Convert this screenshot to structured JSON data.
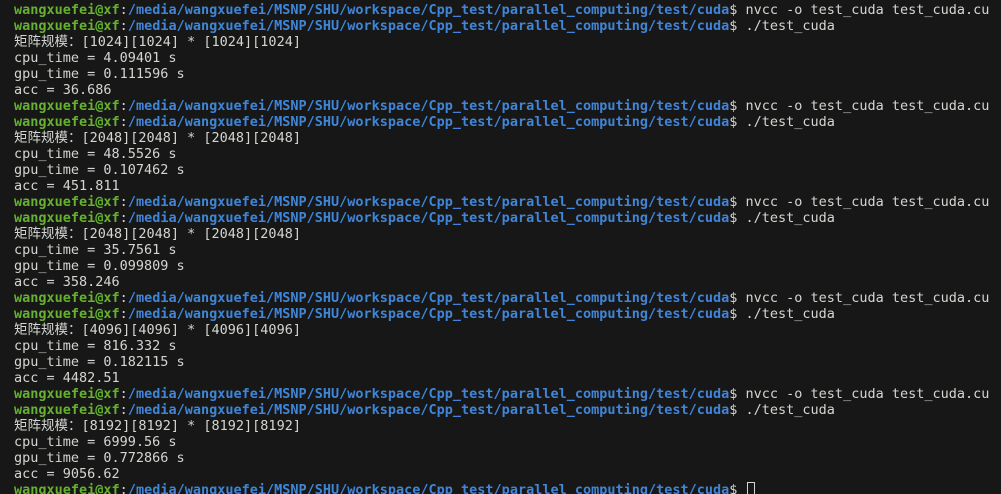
{
  "prompt": {
    "user_host": "wangxuefei@xf",
    "colon": ":",
    "path": "/media/wangxuefei/MSNP/SHU/workspace/Cpp_test/parallel_computing/test/cuda",
    "dollar": "$ "
  },
  "lines": [
    {
      "type": "prompt",
      "command": "nvcc -o test_cuda test_cuda.cu"
    },
    {
      "type": "prompt",
      "command": "./test_cuda"
    },
    {
      "type": "output",
      "text": "矩阵规模：[1024][1024] * [1024][1024]"
    },
    {
      "type": "output",
      "text": "cpu_time = 4.09401 s"
    },
    {
      "type": "output",
      "text": "gpu_time = 0.111596 s"
    },
    {
      "type": "output",
      "text": "acc = 36.686"
    },
    {
      "type": "prompt",
      "command": "nvcc -o test_cuda test_cuda.cu"
    },
    {
      "type": "prompt",
      "command": "./test_cuda"
    },
    {
      "type": "output",
      "text": "矩阵规模：[2048][2048] * [2048][2048]"
    },
    {
      "type": "output",
      "text": "cpu_time = 48.5526 s"
    },
    {
      "type": "output",
      "text": "gpu_time = 0.107462 s"
    },
    {
      "type": "output",
      "text": "acc = 451.811"
    },
    {
      "type": "prompt",
      "command": "nvcc -o test_cuda test_cuda.cu"
    },
    {
      "type": "prompt",
      "command": "./test_cuda"
    },
    {
      "type": "output",
      "text": "矩阵规模：[2048][2048] * [2048][2048]"
    },
    {
      "type": "output",
      "text": "cpu_time = 35.7561 s"
    },
    {
      "type": "output",
      "text": "gpu_time = 0.099809 s"
    },
    {
      "type": "output",
      "text": "acc = 358.246"
    },
    {
      "type": "prompt",
      "command": "nvcc -o test_cuda test_cuda.cu"
    },
    {
      "type": "prompt",
      "command": "./test_cuda"
    },
    {
      "type": "output",
      "text": "矩阵规模：[4096][4096] * [4096][4096]"
    },
    {
      "type": "output",
      "text": "cpu_time = 816.332 s"
    },
    {
      "type": "output",
      "text": "gpu_time = 0.182115 s"
    },
    {
      "type": "output",
      "text": "acc = 4482.51"
    },
    {
      "type": "prompt",
      "command": "nvcc -o test_cuda test_cuda.cu"
    },
    {
      "type": "prompt",
      "command": "./test_cuda"
    },
    {
      "type": "output",
      "text": "矩阵规模：[8192][8192] * [8192][8192]"
    },
    {
      "type": "output",
      "text": "cpu_time = 6999.56 s"
    },
    {
      "type": "output",
      "text": "gpu_time = 0.772866 s"
    },
    {
      "type": "output",
      "text": "acc = 9056.62"
    },
    {
      "type": "prompt_cursor",
      "command": ""
    }
  ],
  "colors": {
    "background": "#171717",
    "user_host": "#65b22e",
    "path": "#3f86d8",
    "text": "#d3d7cf"
  }
}
